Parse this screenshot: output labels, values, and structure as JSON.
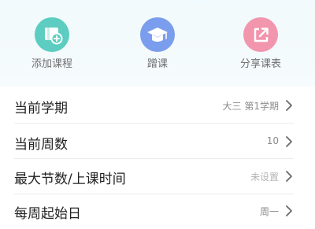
{
  "actions": [
    {
      "label": "添加课程",
      "icon": "add-course-icon",
      "color": "#5ccdc0"
    },
    {
      "label": "蹭课",
      "icon": "graduation-cap-icon",
      "color": "#7b9ded"
    },
    {
      "label": "分享课表",
      "icon": "share-icon",
      "color": "#f296ad"
    }
  ],
  "settings": [
    {
      "title": "当前学期",
      "value": "大三  第1学期"
    },
    {
      "title": "当前周数",
      "value": "10"
    },
    {
      "title": "最大节数/上课时间",
      "value": "未设置"
    },
    {
      "title": "每周起始日",
      "value": "周一"
    }
  ]
}
